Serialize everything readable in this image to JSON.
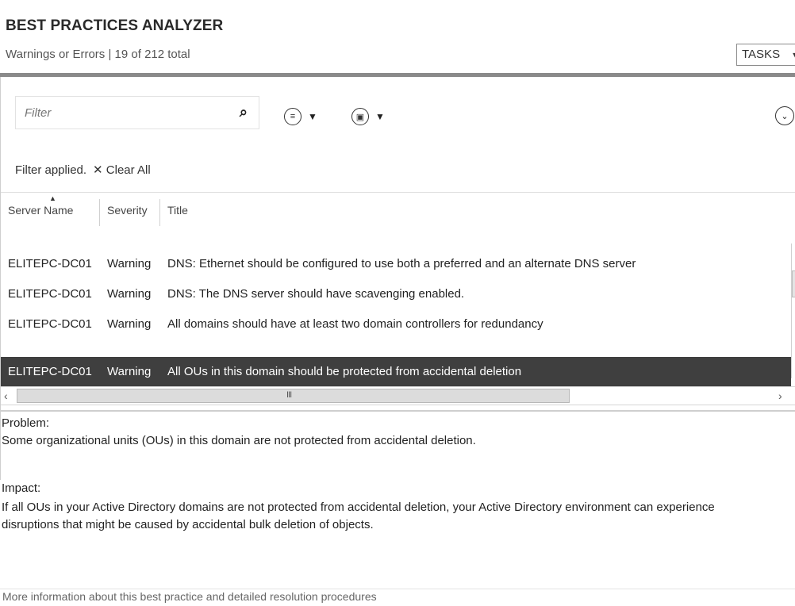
{
  "header": {
    "title": "BEST PRACTICES ANALYZER",
    "subtitle": "Warnings or Errors | 19 of 212 total",
    "tasks_label": "TASKS"
  },
  "toolbar": {
    "filter_placeholder": "Filter",
    "search_icon": "search-icon",
    "list_view_icon": "list-options-icon",
    "save_query_icon": "save-query-icon",
    "expand_icon": "chevron-down-circle-icon"
  },
  "filter_status": {
    "applied_text": "Filter applied.",
    "clear_all_label": "Clear All"
  },
  "table": {
    "columns": [
      "Server Name",
      "Severity",
      "Title"
    ],
    "sort_column": "Server Name",
    "rows": [
      {
        "server": "ELITEPC-DC01",
        "severity": "Warning",
        "title": "DNS: Ethernet should be configured to use both a preferred and an alternate DNS server"
      },
      {
        "server": "ELITEPC-DC01",
        "severity": "Warning",
        "title": "DNS: The DNS server should have scavenging enabled."
      },
      {
        "server": "ELITEPC-DC01",
        "severity": "Warning",
        "title": "All domains should have at least two domain controllers for redundancy"
      },
      {
        "server": "ELITEPC-DC01",
        "severity": "Warning",
        "title": "All OUs in this domain should be protected from accidental deletion"
      }
    ],
    "selected_row": 3,
    "scrollbar_grip": "III"
  },
  "details": {
    "problem_label": "Problem:",
    "problem_text": "Some organizational units (OUs) in this domain are not protected from accidental deletion.",
    "impact_label": "Impact:",
    "impact_text_1": "If all OUs in your Active Directory domains are not protected from accidental deletion, your Active Directory environment can experience",
    "impact_text_2": "disruptions that might be caused by accidental bulk deletion of objects.",
    "more_info_link": "More information about this best practice and detailed resolution procedures"
  },
  "colors": {
    "selected_row_bg": "#3f3f3f",
    "header_rule": "#8a8a8a"
  }
}
